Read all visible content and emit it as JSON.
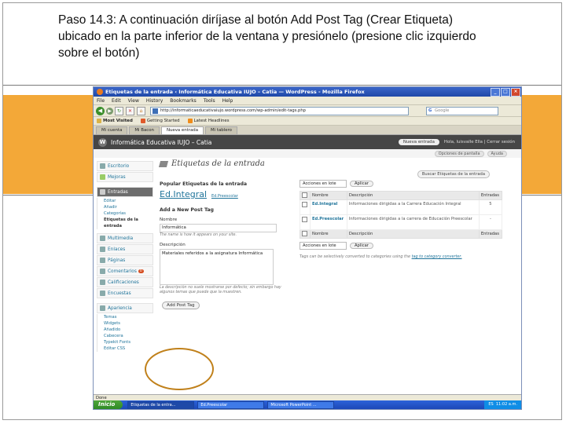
{
  "instruction": "Paso 14.3: A continuación diríjase al botón Add Post Tag (Crear Etiqueta) ubicado en la parte inferior de la ventana y presiónelo (presione clic izquierdo sobre el botón)",
  "colors": {
    "band": "#f3a838",
    "highlight": "#c0801a",
    "wp_link": "#21759b"
  },
  "browser": {
    "title": "Etiquetas de la entrada ‹ Informática Educativa IUJO – Catia — WordPress - Mozilla Firefox",
    "menu": [
      "File",
      "Edit",
      "View",
      "History",
      "Bookmarks",
      "Tools",
      "Help"
    ],
    "url": "http://informaticaeducativaiujo.wordpress.com/wp-admin/edit-tags.php",
    "search_placeholder": "Google",
    "bookmarks": [
      "Most Visited",
      "Getting Started",
      "Latest Headlines"
    ],
    "tabs": [
      "Mi cuenta",
      "Mi Bacon",
      "Nueva entrada",
      "Mi tablero"
    ]
  },
  "wp": {
    "site": "Informática Educativa IUJO – Catia",
    "new_entry": "Nueva entrada",
    "howdy": "Hola, luisvalle Ella | Cerrar sesión",
    "screen_options": "Opciones de pantalla",
    "help": "Ayuda",
    "sidebar": {
      "escritorio": "Escritorio",
      "mejoras": "Mejoras",
      "entradas": "Entradas",
      "entradas_sub": [
        "Editar",
        "Añadir",
        "Categorías",
        "Etiquetas de la entrada"
      ],
      "multimedia": "Multimedia",
      "enlaces": "Enlaces",
      "paginas": "Páginas",
      "comentarios": "Comentarios",
      "comentarios_badge": "0",
      "calificaciones": "Calificaciones",
      "encuestas": "Encuestas",
      "apariencia": "Apariencia",
      "apariencia_sub": [
        "Temas",
        "Widgets",
        "Añadido",
        "Cabecera",
        "Typekit Fonts",
        "Editar CSS"
      ]
    },
    "page_title": "Etiquetas de la entrada",
    "search_tags_button": "Buscar Etiquetas de la entrada",
    "popular_heading": "Popular Etiquetas de la entrada",
    "cloud_tags": [
      "Ed.Integral",
      "Ed.Preescolar"
    ],
    "add_heading": "Add a New Post Tag",
    "name_label": "Nombre",
    "name_value": "Informática",
    "name_help": "The name is how it appears on your site.",
    "desc_label": "Descripción",
    "desc_value": "Materiales referidos a la asignatura Informática",
    "desc_help": "La descripción no suele mostrarse por defecto; sin embargo hay algunos temas que puede que la muestren.",
    "add_button": "Add Post Tag",
    "bulk_select": "Acciones en lote",
    "apply": "Aplicar",
    "table_headers": [
      "Nombre",
      "Descripción",
      "Entradas"
    ],
    "rows": [
      {
        "name": "Ed.Integral",
        "desc": "Informaciones dirigidas a la Carrera Educación Integral",
        "count": "5"
      },
      {
        "name": "Ed.Preescolar",
        "desc": "Informaciones dirigidas a la carrera de Educación Preescolar",
        "count": "-"
      }
    ],
    "note": "Tags can be selectively converted to categories using the",
    "note_link": "tag to category converter."
  },
  "status": "Done",
  "taskbar": {
    "start": "Inicio",
    "items": [
      "Etiquetas de la entra...",
      "Ed.Preescolar",
      "Microsoft PowerPoint ..."
    ],
    "lang": "ES",
    "time": "11:02 a.m."
  }
}
